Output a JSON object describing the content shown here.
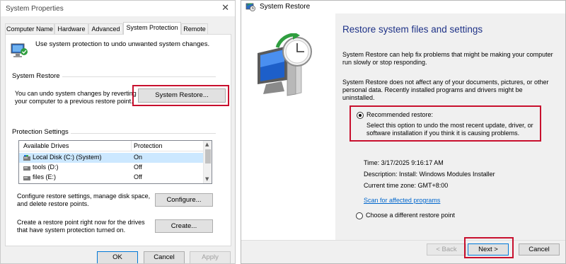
{
  "system_properties": {
    "title": "System Properties",
    "close_glyph": "✕",
    "tabs": [
      {
        "label": "Computer Name"
      },
      {
        "label": "Hardware"
      },
      {
        "label": "Advanced"
      },
      {
        "label": "System Protection"
      },
      {
        "label": "Remote"
      }
    ],
    "active_tab": "System Protection",
    "intro": "Use system protection to undo unwanted system changes.",
    "system_restore": {
      "group_label": "System Restore",
      "description": "You can undo system changes by reverting your computer to a previous restore point.",
      "button_label": "System Restore..."
    },
    "protection_settings": {
      "group_label": "Protection Settings",
      "columns": [
        "Available Drives",
        "Protection"
      ],
      "drives": [
        {
          "name": "Local Disk (C:) (System)",
          "protection": "On",
          "icon": "system-drive-icon",
          "selected": true
        },
        {
          "name": "tools (D:)",
          "protection": "Off",
          "icon": "drive-icon",
          "selected": false
        },
        {
          "name": "files (E:)",
          "protection": "Off",
          "icon": "drive-icon",
          "selected": false
        }
      ],
      "configure_text": "Configure restore settings, manage disk space, and delete restore points.",
      "configure_button": "Configure...",
      "create_text": "Create a restore point right now for the drives that have system protection turned on.",
      "create_button": "Create..."
    },
    "buttons": {
      "ok": "OK",
      "cancel": "Cancel",
      "apply": "Apply"
    }
  },
  "system_restore_wizard": {
    "title": "System Restore",
    "heading": "Restore system files and settings",
    "para1": "System Restore can help fix problems that might be making your computer run slowly or stop responding.",
    "para2": "System Restore does not affect any of your documents, pictures, or other personal data. Recently installed programs and drivers might be uninstalled.",
    "recommended": {
      "label": "Recommended restore:",
      "description": "Select this option to undo the most recent update, driver, or software installation if you think it is causing problems.",
      "selected": true
    },
    "restore_point": {
      "time": "Time: 3/17/2025 9:16:17 AM",
      "description": "Description: Install: Windows Modules Installer",
      "timezone": "Current time zone: GMT+8:00"
    },
    "scan_link": "Scan for affected programs",
    "choose_different": {
      "label": "Choose a different restore point",
      "selected": false
    },
    "buttons": {
      "back": "< Back",
      "next": "Next >",
      "cancel": "Cancel"
    }
  },
  "colors": {
    "highlight_box": "#c8102e",
    "heading": "#1e3287",
    "link": "#0066cc",
    "selection": "#cce8ff"
  }
}
